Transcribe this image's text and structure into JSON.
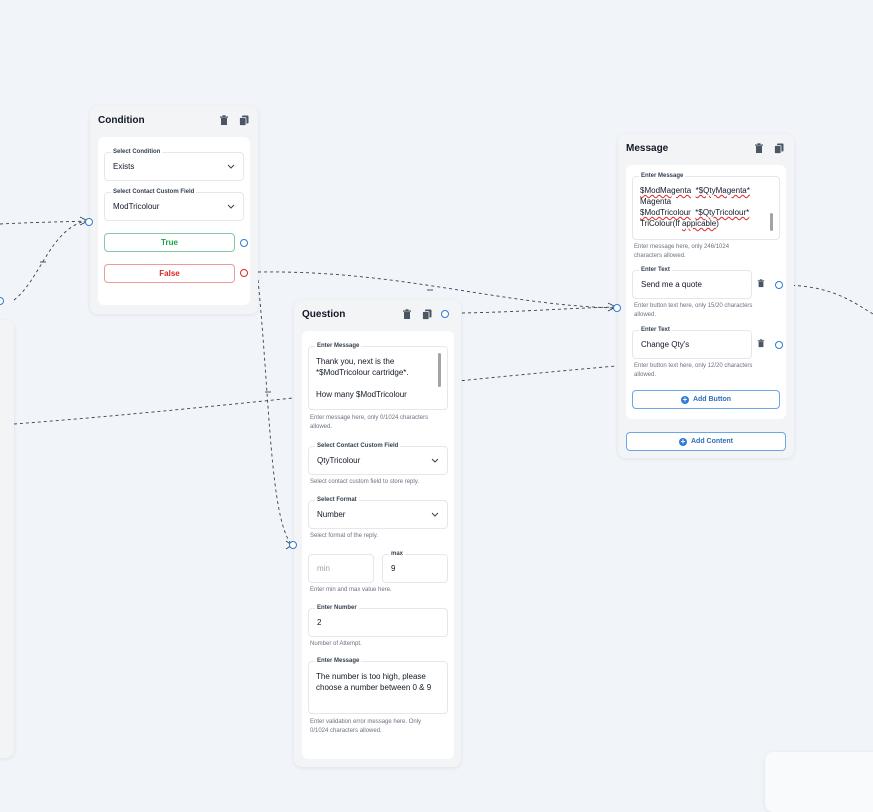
{
  "condition": {
    "title": "Condition",
    "select_condition": {
      "label": "Select Condition",
      "value": "Exists"
    },
    "custom_field": {
      "label": "Select Contact Custom Field",
      "value": "ModTricolour"
    },
    "true_label": "True",
    "false_label": "False"
  },
  "question": {
    "title": "Question",
    "message": {
      "label": "Enter Message",
      "value": "Thank you, next is the\n*$ModTricolour cartridge*.\n\nHow many $ModTricolour",
      "helper": "Enter message here, only 0/1024 characters allowed."
    },
    "custom_field": {
      "label": "Select Contact Custom Field",
      "value": "QtyTricolour",
      "helper": "Select contact custom field to store reply."
    },
    "format": {
      "label": "Select Format",
      "value": "Number",
      "helper": "Select format of the reply."
    },
    "min_placeholder": "min",
    "max": {
      "label": "max",
      "value": "9"
    },
    "minmax_helper": "Enter min and max value here.",
    "attempts": {
      "label": "Enter Number",
      "value": "2",
      "helper": "Number of Attempt."
    },
    "error_message": {
      "label": "Enter Message",
      "value": "The number is too high, please choose a number between 0 & 9",
      "helper": "Enter validation error message here. Only 0/1024 characters allowed."
    }
  },
  "message": {
    "title": "Message",
    "text": {
      "label": "Enter Message",
      "line1a": "$ModMagenta",
      "line1b": "*$QtyMagenta*",
      "line2": "Magenta",
      "line3a": "$ModTricolour",
      "line3b": "*$QtyTricolour*",
      "line4a": "TriColour(If ",
      "line4b": "appicable",
      "line4c": ")",
      "helper": "Enter message here, only 246/1024 characters allowed."
    },
    "buttons": [
      {
        "label": "Enter Text",
        "value": "Send me a quote",
        "helper": "Enter button text here, only 15/20 characters allowed."
      },
      {
        "label": "Enter Text",
        "value": "Change Qty's",
        "helper": "Enter button text here, only 12/20 characters allowed."
      }
    ],
    "add_button": "Add Button",
    "add_content": "Add Content"
  },
  "colors": {
    "accent": "#2f7bd6",
    "true": "#16a34a",
    "false": "#dc2626",
    "canvas": "#f1f5fa"
  }
}
